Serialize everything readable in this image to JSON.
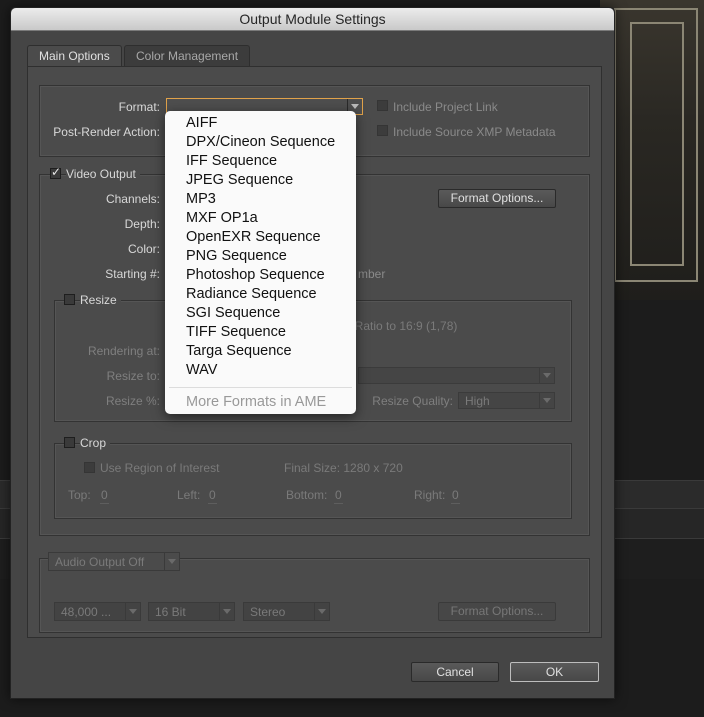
{
  "dialog": {
    "title": "Output Module Settings",
    "tabs": [
      {
        "label": "Main Options",
        "active": true
      },
      {
        "label": "Color Management",
        "active": false
      }
    ]
  },
  "format_section": {
    "format_label": "Format:",
    "format_value": "",
    "post_render_label": "Post-Render Action:",
    "include_project_link_label": "Include Project Link",
    "include_project_link_checked": false,
    "include_xmp_label": "Include Source XMP Metadata",
    "include_xmp_checked": false
  },
  "video": {
    "video_output_label": "Video Output",
    "video_output_checked": true,
    "channels_label": "Channels:",
    "depth_label": "Depth:",
    "color_label": "Color:",
    "starting_label": "Starting #:",
    "starting_suffix": "mber",
    "format_options_button": "Format Options..."
  },
  "resize": {
    "label": "Resize",
    "checked": false,
    "aspect_text": "t Ratio to 16:9 (1,78)",
    "rendering_at_label": "Rendering at:",
    "resize_to_label": "Resize to:",
    "resize_pct_label": "Resize %:",
    "resize_quality_label": "Resize Quality:",
    "resize_quality_value": "High"
  },
  "crop": {
    "label": "Crop",
    "checked": false,
    "use_roi_label": "Use Region of Interest",
    "final_size_label": "Final Size: 1280 x 720",
    "top_label": "Top:",
    "top_value": "0",
    "left_label": "Left:",
    "left_value": "0",
    "bottom_label": "Bottom:",
    "bottom_value": "0",
    "right_label": "Right:",
    "right_value": "0"
  },
  "audio": {
    "output_value": "Audio Output Off",
    "sample_rate": "48,000 ...",
    "bit_depth": "16 Bit",
    "channels": "Stereo",
    "format_options_button": "Format Options..."
  },
  "footer": {
    "cancel_button": "Cancel",
    "ok_button": "OK"
  },
  "format_menu": {
    "items": [
      "AIFF",
      "DPX/Cineon Sequence",
      "IFF Sequence",
      "JPEG Sequence",
      "MP3",
      "MXF OP1a",
      "OpenEXR Sequence",
      "PNG Sequence",
      "Photoshop Sequence",
      "Radiance Sequence",
      "SGI Sequence",
      "TIFF Sequence",
      "Targa Sequence",
      "WAV"
    ],
    "more_item": "More Formats in AME"
  },
  "colors": {
    "focus_border": "#e0a24a",
    "dialog_bg": "#454545",
    "menu_bg": "#fafafa"
  }
}
